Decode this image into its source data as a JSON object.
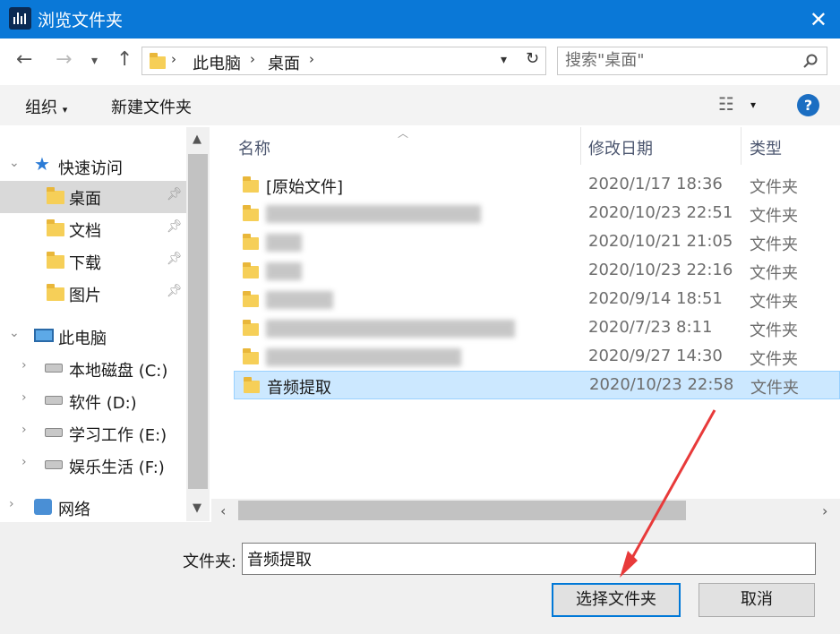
{
  "window": {
    "title": "浏览文件夹",
    "close_icon": "close-icon"
  },
  "address": {
    "crumbs": [
      "此电脑",
      "桌面"
    ]
  },
  "search": {
    "placeholder": "搜索\"桌面\""
  },
  "toolbar": {
    "organize": "组织",
    "new_folder": "新建文件夹"
  },
  "nav": {
    "quick_access": "快速访问",
    "items": [
      "桌面",
      "文档",
      "下载",
      "图片"
    ],
    "this_pc": "此电脑",
    "drives": [
      "本地磁盘 (C:)",
      "软件 (D:)",
      "学习工作 (E:)",
      "娱乐生活 (F:)"
    ],
    "network": "网络"
  },
  "list": {
    "headers": {
      "name": "名称",
      "date": "修改日期",
      "type": "类型"
    },
    "rows": [
      {
        "name": "[原始文件]",
        "date": "2020/1/17 18:36",
        "type": "文件夹"
      },
      {
        "name": "",
        "date": "2020/10/23 22:51",
        "type": "文件夹"
      },
      {
        "name": "",
        "date": "2020/10/21 21:05",
        "type": "文件夹"
      },
      {
        "name": "",
        "date": "2020/10/23 22:16",
        "type": "文件夹"
      },
      {
        "name": "",
        "date": "2020/9/14 18:51",
        "type": "文件夹"
      },
      {
        "name": "",
        "date": "2020/7/23 8:11",
        "type": "文件夹"
      },
      {
        "name": "",
        "date": "2020/9/27 14:30",
        "type": "文件夹"
      },
      {
        "name": "音频提取",
        "date": "2020/10/23 22:58",
        "type": "文件夹"
      }
    ]
  },
  "footer": {
    "folder_label": "文件夹:",
    "folder_value": "音频提取",
    "select_button": "选择文件夹",
    "cancel_button": "取消"
  }
}
